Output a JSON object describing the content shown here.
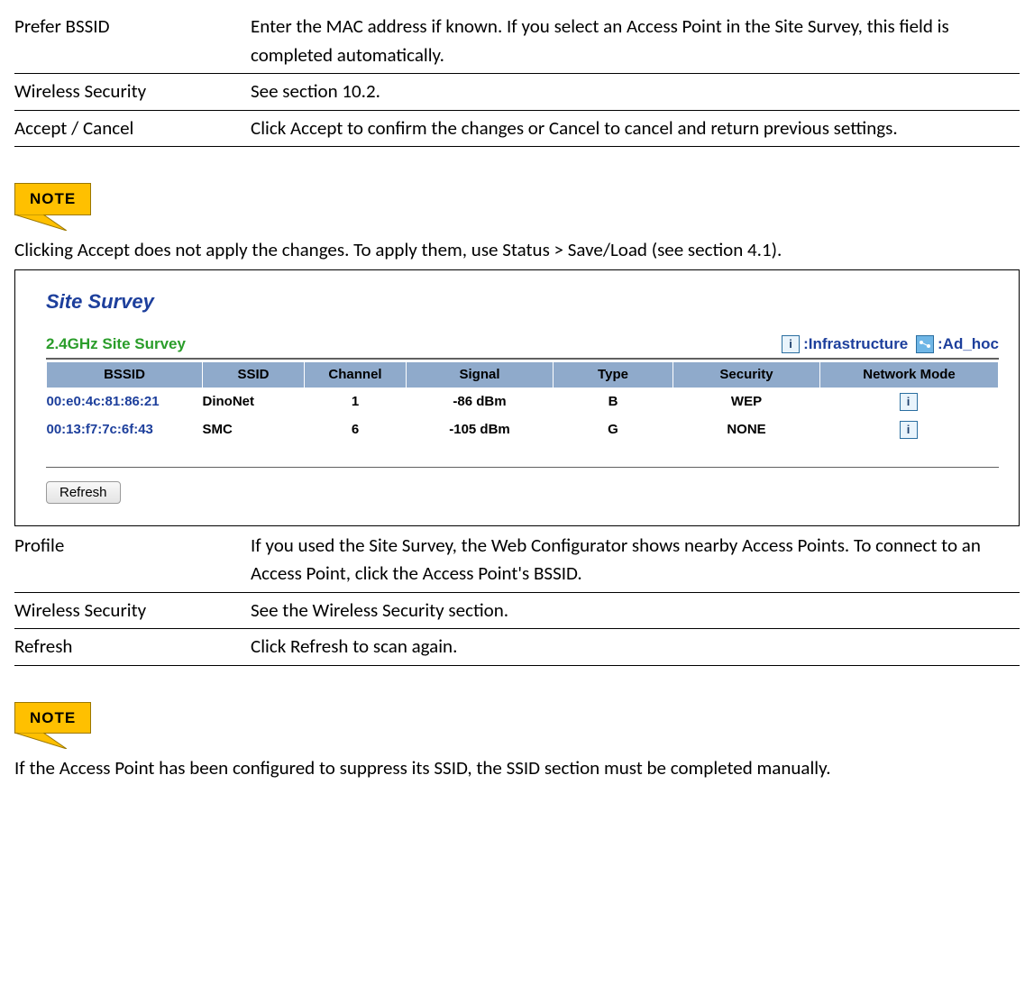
{
  "defs1": [
    {
      "term": "Prefer  BSSID",
      "desc": "Enter the MAC address if known. If you select an Access Point in the Site Survey, this field is completed automatically."
    },
    {
      "term": "Wireless  Security",
      "desc": "See section 10.2."
    },
    {
      "term": "Accept  / Cancel",
      "desc": "Click Accept  to confirm the changes or Cancel  to cancel and return previous settings."
    }
  ],
  "note1": {
    "badge": "NOTE",
    "text": "Clicking Accept  does not apply the changes. To apply them, use Status  >  Save/Load   (see section 4.1)."
  },
  "survey": {
    "title": "Site Survey",
    "subtitle": "2.4GHz Site Survey",
    "legend_infra": ":Infrastructure",
    "legend_adhoc": ":Ad_hoc",
    "headers": [
      "BSSID",
      "SSID",
      "Channel",
      "Signal",
      "Type",
      "Security",
      "Network Mode"
    ],
    "rows": [
      {
        "bssid": "00:e0:4c:81:86:21",
        "ssid": "DinoNet",
        "channel": "1",
        "signal": "-86 dBm",
        "type": "B",
        "security": "WEP",
        "mode": "infra"
      },
      {
        "bssid": "00:13:f7:7c:6f:43",
        "ssid": "SMC",
        "channel": "6",
        "signal": "-105 dBm",
        "type": "G",
        "security": "NONE",
        "mode": "infra"
      }
    ],
    "refresh_label": "Refresh"
  },
  "defs2": [
    {
      "term": "Profile",
      "desc": "If you used the Site Survey, the Web Configurator shows nearby Access Points. To connect to an Access Point, click the Access Point's BSSID."
    },
    {
      "term": "Wireless  Security",
      "desc": "See the Wireless Security section."
    },
    {
      "term": "Refresh",
      "desc": "Click Refresh  to scan again."
    }
  ],
  "note2": {
    "badge": "NOTE",
    "text": "If the Access Point has been configured to suppress its SSID, the SSID  section must be completed manually."
  }
}
